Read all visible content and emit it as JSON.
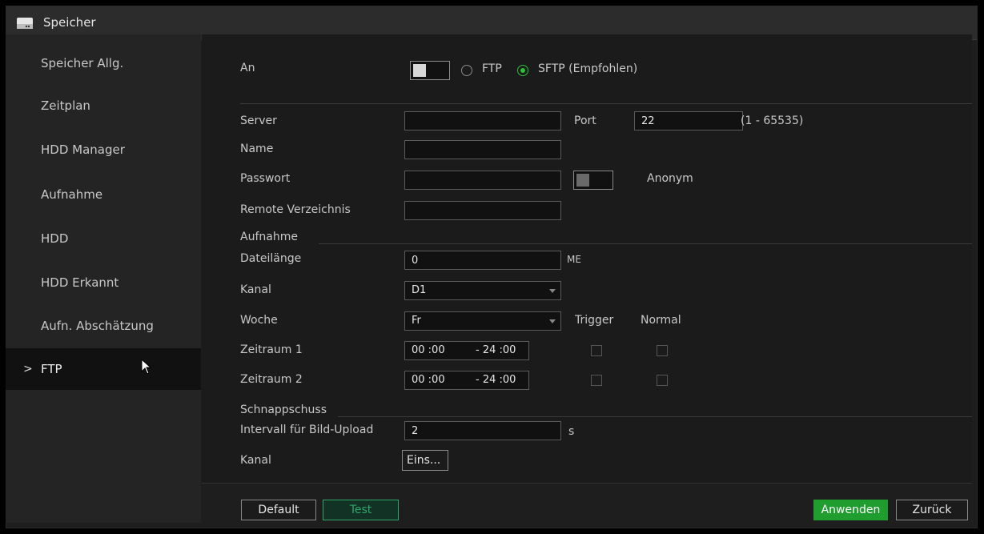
{
  "window": {
    "title": "Speicher"
  },
  "sidebar": {
    "items": [
      {
        "label": "Speicher Allg."
      },
      {
        "label": "Zeitplan"
      },
      {
        "label": "HDD Manager"
      },
      {
        "label": "Aufnahme"
      },
      {
        "label": "HDD"
      },
      {
        "label": "HDD Erkannt"
      },
      {
        "label": "Aufn. Abschätzung"
      },
      {
        "label": "FTP",
        "active": true
      }
    ],
    "active_chevron": ">"
  },
  "ftp": {
    "enable_label": "An",
    "protocol_ftp": "FTP",
    "protocol_sftp": "SFTP (Empfohlen)",
    "selected_protocol": "SFTP (Empfohlen)",
    "server_label": "Server",
    "server_value": "",
    "port_label": "Port",
    "port_value": "22",
    "port_range": "(1 - 65535)",
    "name_label": "Name",
    "name_value": "",
    "password_label": "Passwort",
    "password_value": "",
    "anonym_label": "Anonym",
    "remote_dir_label": "Remote Verzeichnis",
    "remote_dir_value": ""
  },
  "recording": {
    "section_label": "Aufnahme",
    "file_length_label": "Dateilänge",
    "file_length_value": "0",
    "file_length_unit": "ME",
    "channel_label": "Kanal",
    "channel_value": "D1",
    "week_label": "Woche",
    "week_value": "Fr",
    "trigger_label": "Trigger",
    "normal_label": "Normal",
    "period1_label": "Zeitraum 1",
    "period1_start": "00 :00",
    "period1_end": "- 24 :00",
    "period2_label": "Zeitraum 2",
    "period2_start": "00 :00",
    "period2_end": "- 24 :00"
  },
  "snapshot": {
    "section_label": "Schnappschuss",
    "interval_label": "Intervall für Bild-Upload",
    "interval_value": "2",
    "interval_unit": "s",
    "channel_label": "Kanal",
    "channel_button": "Eins..."
  },
  "footer": {
    "default_label": "Default",
    "test_label": "Test",
    "apply_label": "Anwenden",
    "back_label": "Zurück"
  },
  "colors": {
    "accent_green": "#1f9d2f",
    "radio_green": "#2fbf3a",
    "test_green": "#2fa66a",
    "background": "#1b1b1b"
  }
}
